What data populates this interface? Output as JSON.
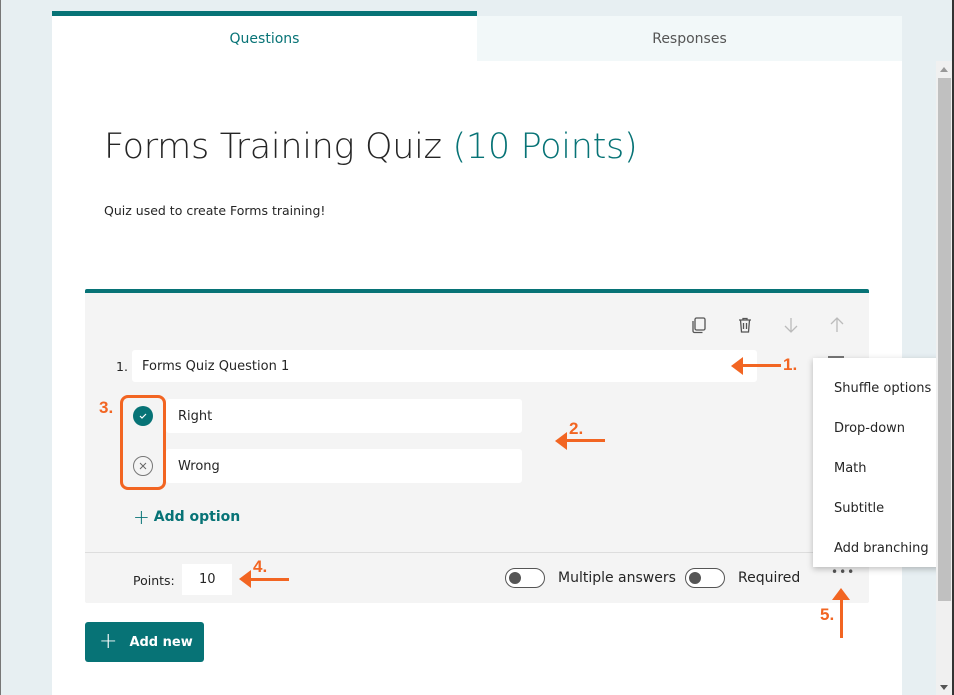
{
  "tabs": [
    {
      "label": "Questions",
      "active": true
    },
    {
      "label": "Responses",
      "active": false
    }
  ],
  "form": {
    "title": "Forms Training Quiz",
    "points_suffix": "(10 Points)",
    "description": "Quiz used to create Forms training!"
  },
  "question": {
    "number": "1.",
    "text": "Forms Quiz Question 1",
    "options": [
      {
        "label": "Right",
        "correct": true
      },
      {
        "label": "Wrong",
        "correct": false
      }
    ],
    "add_option_label": "Add option",
    "points_label": "Points:",
    "points_value": "10",
    "toggles": [
      {
        "label": "Multiple answers",
        "on": false
      },
      {
        "label": "Required",
        "on": false
      }
    ],
    "toolbar": [
      "copy",
      "delete",
      "move-down",
      "move-up"
    ],
    "more_label": "•••"
  },
  "add_new_label": "Add new",
  "menu": {
    "items": [
      "Shuffle options",
      "Drop-down",
      "Math",
      "Subtitle",
      "Add branching"
    ]
  },
  "annotations": [
    "1.",
    "2.",
    "3.",
    "4.",
    "5."
  ],
  "colors": {
    "accent": "#077376",
    "annotation": "#f26522"
  }
}
